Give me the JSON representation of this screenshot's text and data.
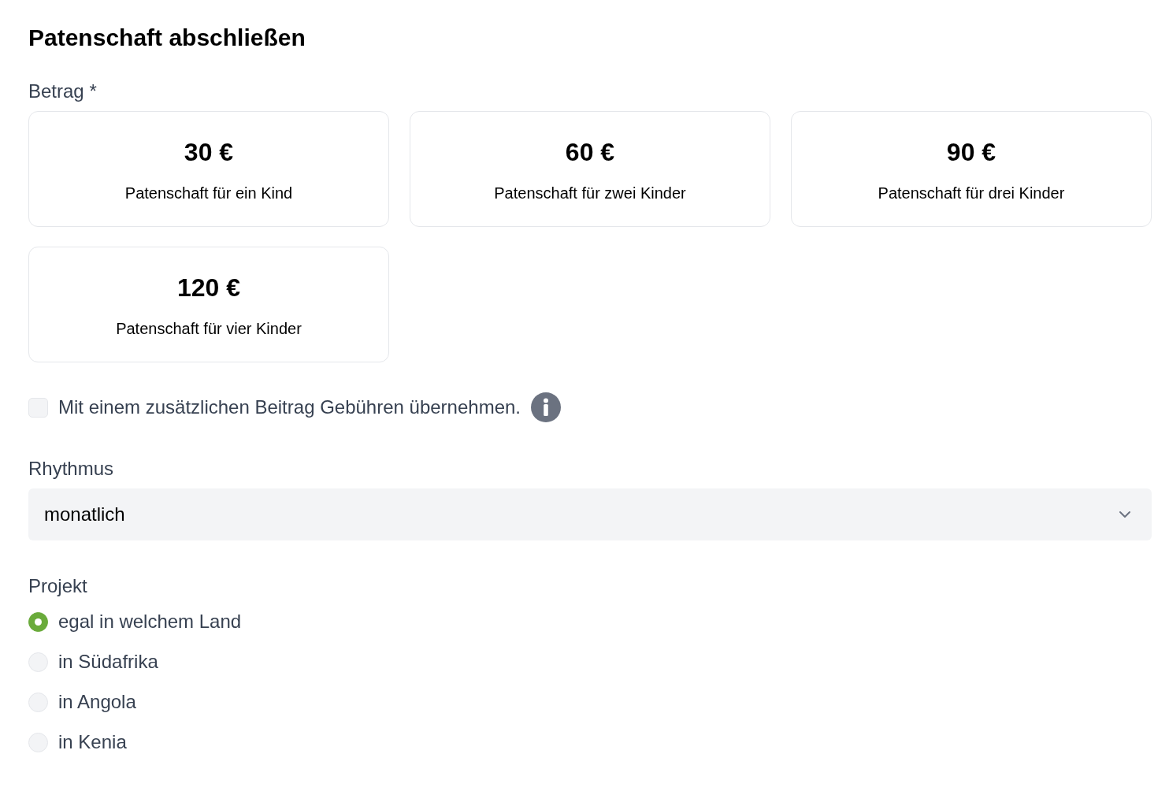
{
  "title": "Patenschaft abschließen",
  "amount": {
    "label": "Betrag *",
    "options": [
      {
        "price": "30 €",
        "description": "Patenschaft für ein Kind",
        "selected": false
      },
      {
        "price": "60 €",
        "description": "Patenschaft für zwei Kinder",
        "selected": false
      },
      {
        "price": "90 €",
        "description": "Patenschaft für drei Kinder",
        "selected": false
      },
      {
        "price": "120 €",
        "description": "Patenschaft für vier Kinder",
        "selected": false
      }
    ]
  },
  "fee_option": {
    "label": "Mit einem zusätzlichen Beitrag Gebühren übernehmen.",
    "checked": false
  },
  "rhythm": {
    "label": "Rhythmus",
    "value": "monatlich"
  },
  "project": {
    "label": "Projekt",
    "options": [
      {
        "label": "egal in welchem Land",
        "selected": true
      },
      {
        "label": "in Südafrika",
        "selected": false
      },
      {
        "label": "in Angola",
        "selected": false
      },
      {
        "label": "in Kenia",
        "selected": false
      }
    ]
  }
}
